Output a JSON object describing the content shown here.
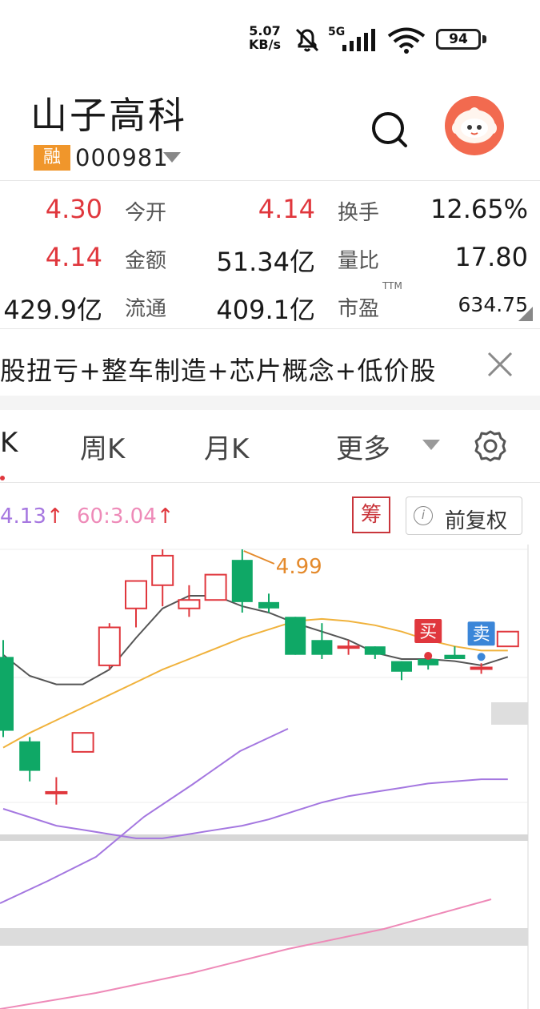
{
  "status_bar": {
    "net_speed_value": "5.07",
    "net_speed_unit": "KB/s",
    "network_type": "5G",
    "battery": "94"
  },
  "header": {
    "stock_name": "山子高科",
    "margin_badge": "融",
    "stock_code": "000981"
  },
  "quote": {
    "rows": [
      {
        "v1": "4.30",
        "l1": "今开",
        "v2": "4.14",
        "l2": "换手",
        "v3": "12.65%"
      },
      {
        "v1": "4.14",
        "l1": "金额",
        "v2": "51.34亿",
        "l2": "量比",
        "v3": "17.80"
      },
      {
        "v1": "429.9亿",
        "l1": "流通",
        "v2": "409.1亿",
        "l2": "市盈",
        "v3": "634.75"
      }
    ],
    "pe_suffix": "TTM"
  },
  "concepts": "股扭亏+整车制造+芯片概念+低价股",
  "tabs": {
    "day": "K",
    "week": "周K",
    "month": "月K",
    "more": "更多"
  },
  "indicators": {
    "ma_a": "4.13",
    "ma_b": "60:3.04",
    "chip_label": "筹",
    "adjust_label": "前复权"
  },
  "chart_data": {
    "type": "candlestick",
    "candles": [
      {
        "open": 4.48,
        "close": 4.13,
        "high": 4.56,
        "low": 4.1
      },
      {
        "open": 4.08,
        "close": 3.94,
        "high": 4.1,
        "low": 3.89
      },
      {
        "open": 3.84,
        "close": 3.84,
        "high": 3.91,
        "low": 3.78
      },
      {
        "open": 4.03,
        "close": 4.12,
        "high": 4.12,
        "low": 4.03
      },
      {
        "open": 4.44,
        "close": 4.62,
        "high": 4.64,
        "low": 4.42
      },
      {
        "open": 4.71,
        "close": 4.84,
        "high": 4.84,
        "low": 4.62
      },
      {
        "open": 4.82,
        "close": 4.96,
        "high": 4.99,
        "low": 4.72
      },
      {
        "open": 4.71,
        "close": 4.75,
        "high": 4.82,
        "low": 4.67
      },
      {
        "open": 4.75,
        "close": 4.87,
        "high": 4.87,
        "low": 4.75
      },
      {
        "open": 4.94,
        "close": 4.74,
        "high": 4.99,
        "low": 4.69
      },
      {
        "open": 4.74,
        "close": 4.71,
        "high": 4.78,
        "low": 4.69
      },
      {
        "open": 4.67,
        "close": 4.49,
        "high": 4.67,
        "low": 4.49
      },
      {
        "open": 4.56,
        "close": 4.49,
        "high": 4.64,
        "low": 4.47
      },
      {
        "open": 4.53,
        "close": 4.53,
        "high": 4.56,
        "low": 4.49
      },
      {
        "open": 4.53,
        "close": 4.49,
        "high": 4.53,
        "low": 4.47
      },
      {
        "open": 4.46,
        "close": 4.41,
        "high": 4.46,
        "low": 4.37
      },
      {
        "open": 4.47,
        "close": 4.44,
        "high": 4.47,
        "low": 4.42
      },
      {
        "open": 4.49,
        "close": 4.47,
        "high": 4.53,
        "low": 4.47
      },
      {
        "open": 4.43,
        "close": 4.43,
        "high": 4.45,
        "low": 4.4
      },
      {
        "open": 4.53,
        "close": 4.6,
        "high": 4.6,
        "low": 4.53
      }
    ],
    "ma_short": [
      4.49,
      4.39,
      4.35,
      4.35,
      4.42,
      4.57,
      4.71,
      4.77,
      4.77,
      4.72,
      4.69,
      4.64,
      4.6,
      4.56,
      4.5,
      4.47,
      4.47,
      4.46,
      4.44,
      4.48
    ],
    "ma_mid": [
      4.05,
      4.12,
      4.18,
      4.24,
      4.3,
      4.36,
      4.42,
      4.47,
      4.52,
      4.57,
      4.61,
      4.65,
      4.66,
      4.65,
      4.63,
      4.6,
      4.56,
      4.53,
      4.51,
      4.51
    ],
    "ma_long": [
      3.76,
      3.72,
      3.68,
      3.66,
      3.64,
      3.62,
      3.62,
      3.64,
      3.66,
      3.68,
      3.71,
      3.75,
      3.79,
      3.82,
      3.84,
      3.86,
      3.88,
      3.89,
      3.9,
      3.9
    ],
    "high_marker": "4.99",
    "buy_label": "买",
    "sell_label": "卖",
    "ylim": [
      3.76,
      4.99
    ]
  },
  "colors": {
    "up": "#e0373d",
    "down": "#0fa866",
    "ma_short": "#555555",
    "ma_mid": "#f0b23c",
    "ma_long": "#a477e0",
    "ma_60": "#ee8ab8",
    "marker": "#e48a2c"
  }
}
